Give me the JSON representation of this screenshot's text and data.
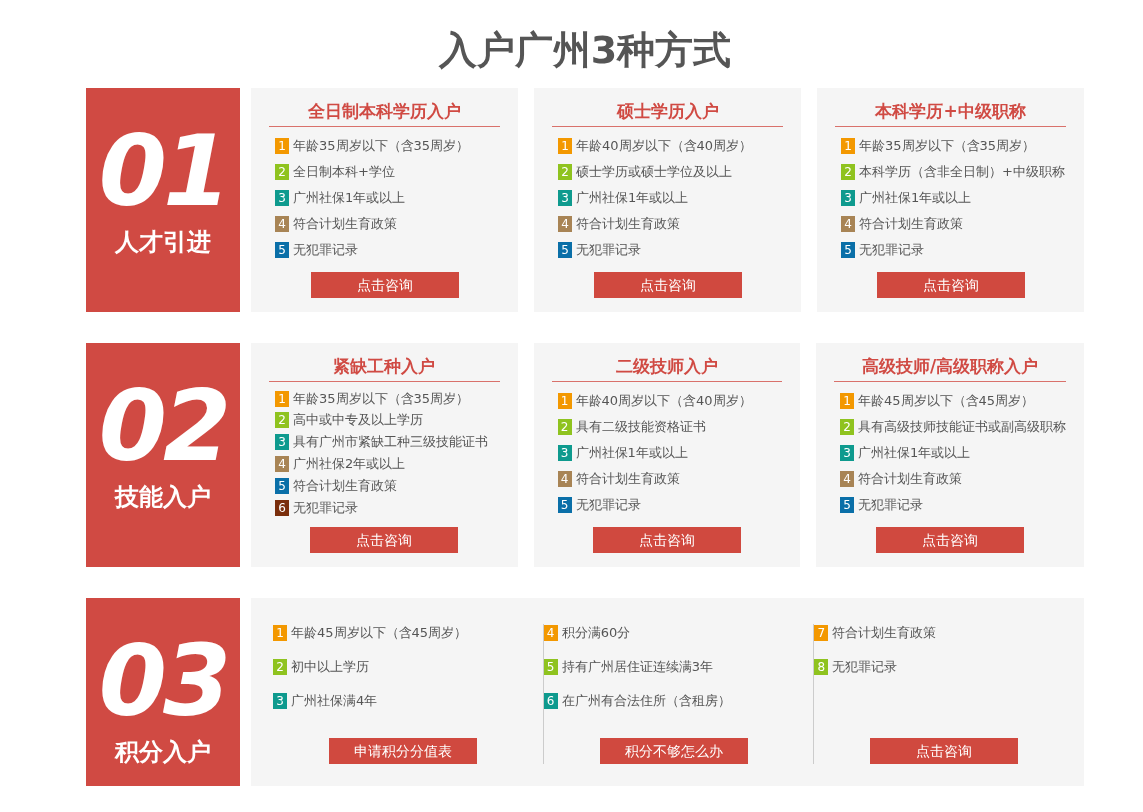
{
  "title": "入户广州3种方式",
  "sections": [
    {
      "number": "01",
      "label": "人才引进",
      "kind": "cards",
      "cards": [
        {
          "title": "全日制本科学历入户",
          "button": "点击咨询",
          "items": [
            {
              "num": "1",
              "text": "年龄35周岁以下（含35周岁）",
              "color": "#f39800"
            },
            {
              "num": "2",
              "text": "全日制本科+学位",
              "color": "#8fc31f"
            },
            {
              "num": "3",
              "text": "广州社保1年或以上",
              "color": "#0e9a8e"
            },
            {
              "num": "4",
              "text": "符合计划生育政策",
              "color": "#a88455"
            },
            {
              "num": "5",
              "text": "无犯罪记录",
              "color": "#0a6fa8"
            }
          ]
        },
        {
          "title": "硕士学历入户",
          "button": "点击咨询",
          "items": [
            {
              "num": "1",
              "text": "年龄40周岁以下（含40周岁）",
              "color": "#f39800"
            },
            {
              "num": "2",
              "text": "硕士学历或硕士学位及以上",
              "color": "#8fc31f"
            },
            {
              "num": "3",
              "text": "广州社保1年或以上",
              "color": "#0e9a8e"
            },
            {
              "num": "4",
              "text": "符合计划生育政策",
              "color": "#a88455"
            },
            {
              "num": "5",
              "text": "无犯罪记录",
              "color": "#0a6fa8"
            }
          ]
        },
        {
          "title": "本科学历+中级职称",
          "button": "点击咨询",
          "items": [
            {
              "num": "1",
              "text": "年龄35周岁以下（含35周岁）",
              "color": "#f39800"
            },
            {
              "num": "2",
              "text": "本科学历（含非全日制）+中级职称",
              "color": "#8fc31f"
            },
            {
              "num": "3",
              "text": "广州社保1年或以上",
              "color": "#0e9a8e"
            },
            {
              "num": "4",
              "text": "符合计划生育政策",
              "color": "#a88455"
            },
            {
              "num": "5",
              "text": "无犯罪记录",
              "color": "#0a6fa8"
            }
          ]
        }
      ]
    },
    {
      "number": "02",
      "label": "技能入户",
      "kind": "cards",
      "cards": [
        {
          "title": "紧缺工种入户",
          "button": "点击咨询",
          "items": [
            {
              "num": "1",
              "text": "年龄35周岁以下（含35周岁）",
              "color": "#f39800"
            },
            {
              "num": "2",
              "text": "高中或中专及以上学历",
              "color": "#8fc31f"
            },
            {
              "num": "3",
              "text": "具有广州市紧缺工种三级技能证书",
              "color": "#0e9a8e"
            },
            {
              "num": "4",
              "text": "广州社保2年或以上",
              "color": "#a88455"
            },
            {
              "num": "5",
              "text": "符合计划生育政策",
              "color": "#0a6fa8"
            },
            {
              "num": "6",
              "text": "无犯罪记录",
              "color": "#7a2e0c"
            }
          ]
        },
        {
          "title": "二级技师入户",
          "button": "点击咨询",
          "items": [
            {
              "num": "1",
              "text": "年龄40周岁以下（含40周岁）",
              "color": "#f39800"
            },
            {
              "num": "2",
              "text": "具有二级技能资格证书",
              "color": "#8fc31f"
            },
            {
              "num": "3",
              "text": "广州社保1年或以上",
              "color": "#0e9a8e"
            },
            {
              "num": "4",
              "text": "符合计划生育政策",
              "color": "#a88455"
            },
            {
              "num": "5",
              "text": "无犯罪记录",
              "color": "#0a6fa8"
            }
          ]
        },
        {
          "title": "高级技师/高级职称入户",
          "button": "点击咨询",
          "items": [
            {
              "num": "1",
              "text": "年龄45周岁以下（含45周岁）",
              "color": "#f39800"
            },
            {
              "num": "2",
              "text": "具有高级技师技能证书或副高级职称",
              "color": "#8fc31f"
            },
            {
              "num": "3",
              "text": "广州社保1年或以上",
              "color": "#0e9a8e"
            },
            {
              "num": "4",
              "text": "符合计划生育政策",
              "color": "#a88455"
            },
            {
              "num": "5",
              "text": "无犯罪记录",
              "color": "#0a6fa8"
            }
          ]
        }
      ]
    },
    {
      "number": "03",
      "label": "积分入户",
      "kind": "columns",
      "columns": [
        {
          "button": "申请积分分值表",
          "items": [
            {
              "num": "1",
              "text": "年龄45周岁以下（含45周岁）",
              "color": "#f39800"
            },
            {
              "num": "2",
              "text": "初中以上学历",
              "color": "#8fc31f"
            },
            {
              "num": "3",
              "text": "广州社保满4年",
              "color": "#0e9a8e"
            }
          ]
        },
        {
          "button": "积分不够怎么办",
          "items": [
            {
              "num": "4",
              "text": "积分满60分",
              "color": "#f39800"
            },
            {
              "num": "5",
              "text": "持有广州居住证连续满3年",
              "color": "#8fc31f"
            },
            {
              "num": "6",
              "text": "在广州有合法住所（含租房）",
              "color": "#0e9a8e"
            }
          ]
        },
        {
          "button": "点击咨询",
          "items": [
            {
              "num": "7",
              "text": "符合计划生育政策",
              "color": "#f39800"
            },
            {
              "num": "8",
              "text": "无犯罪记录",
              "color": "#8fc31f"
            }
          ]
        }
      ]
    }
  ]
}
